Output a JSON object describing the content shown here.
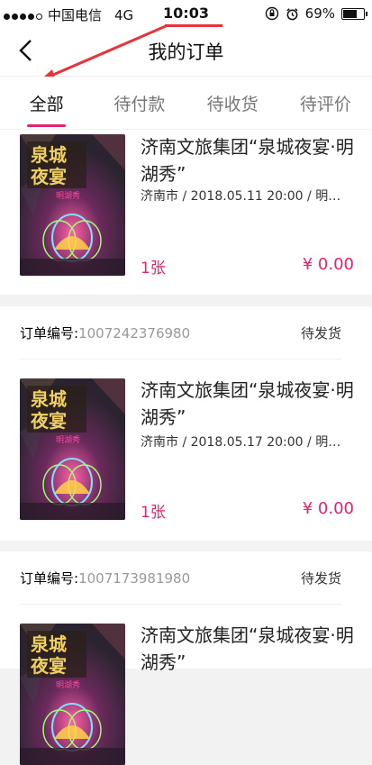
{
  "status_bar": {
    "carrier": "中国电信",
    "network": "4G",
    "time": "10:03",
    "battery": "69%"
  },
  "header": {
    "title": "我的订单"
  },
  "tabs": [
    {
      "label": "全部"
    },
    {
      "label": "待付款"
    },
    {
      "label": "待收货"
    },
    {
      "label": "待评价"
    }
  ],
  "poster": {
    "line1": "泉城",
    "line2": "夜宴",
    "line3": "明湖秀"
  },
  "orders": [
    {
      "order_label": "",
      "order_no": "",
      "status": "",
      "name": "济南文旅集团“泉城夜宴·明湖秀”",
      "meta": "济南市 / 2018.05.11 20:00 / 明…",
      "qty": "1张",
      "price": "¥ 0.00"
    },
    {
      "order_label": "订单编号:",
      "order_no": "1007242376980",
      "status": "待发货",
      "name": "济南文旅集团“泉城夜宴·明湖秀”",
      "meta": "济南市 / 2018.05.17 20:00 / 明…",
      "qty": "1张",
      "price": "¥ 0.00"
    },
    {
      "order_label": "订单编号:",
      "order_no": "1007173981980",
      "status": "待发货",
      "name": "济南文旅集团“泉城夜宴·明湖秀”",
      "meta": "",
      "qty": "",
      "price": ""
    }
  ]
}
